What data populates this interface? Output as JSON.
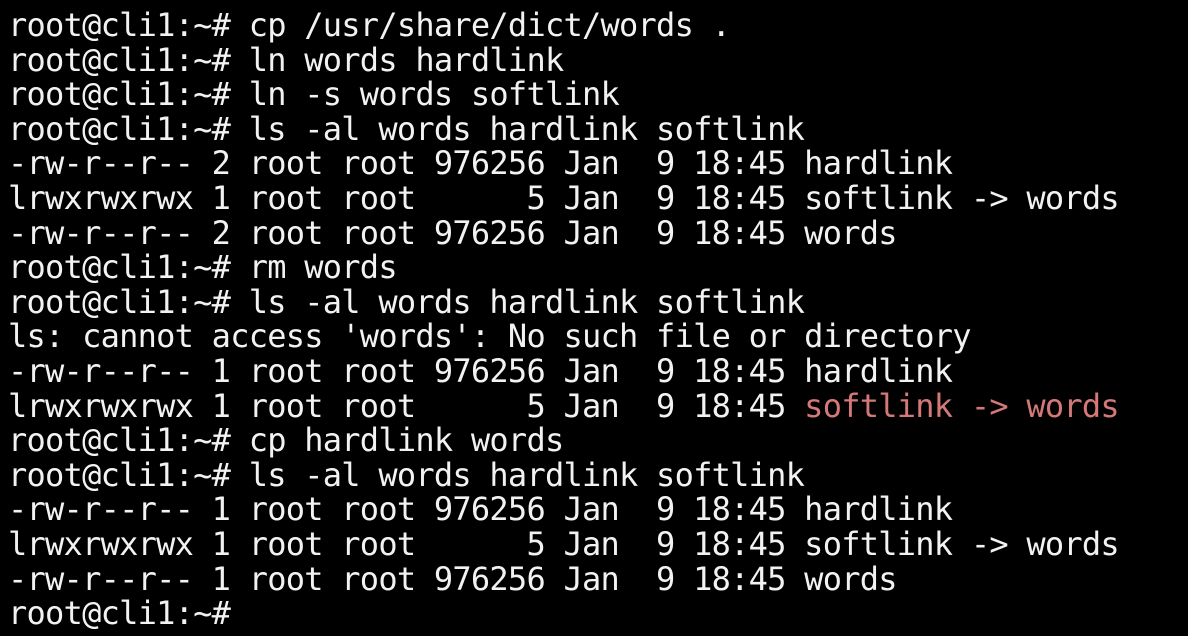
{
  "terminal": {
    "lines": [
      {
        "text": "root@cli1:~# cp /usr/share/dict/words ."
      },
      {
        "text": "root@cli1:~# ln words hardlink"
      },
      {
        "text": "root@cli1:~# ln -s words softlink"
      },
      {
        "text": "root@cli1:~# ls -al words hardlink softlink"
      },
      {
        "text": "-rw-r--r-- 2 root root 976256 Jan  9 18:45 hardlink"
      },
      {
        "text": "lrwxrwxrwx 1 root root      5 Jan  9 18:45 softlink -> words"
      },
      {
        "text": "-rw-r--r-- 2 root root 976256 Jan  9 18:45 words"
      },
      {
        "text": "root@cli1:~# rm words"
      },
      {
        "text": "root@cli1:~# ls -al words hardlink softlink"
      },
      {
        "text": "ls: cannot access 'words': No such file or directory"
      },
      {
        "text": "-rw-r--r-- 1 root root 976256 Jan  9 18:45 hardlink"
      },
      {
        "prefix": "lrwxrwxrwx 1 root root      5 Jan  9 18:45 ",
        "link": "softlink",
        "arrow": " -> ",
        "target": "words"
      },
      {
        "text": "root@cli1:~# cp hardlink words"
      },
      {
        "text": "root@cli1:~# ls -al words hardlink softlink"
      },
      {
        "text": "-rw-r--r-- 1 root root 976256 Jan  9 18:45 hardlink"
      },
      {
        "text": "lrwxrwxrwx 1 root root      5 Jan  9 18:45 softlink -> words"
      },
      {
        "text": "-rw-r--r-- 1 root root 976256 Jan  9 18:45 words"
      },
      {
        "text": "root@cli1:~#"
      }
    ]
  },
  "colors": {
    "background": "#000000",
    "foreground": "#f2f2f2",
    "broken_link": "#d47878"
  }
}
